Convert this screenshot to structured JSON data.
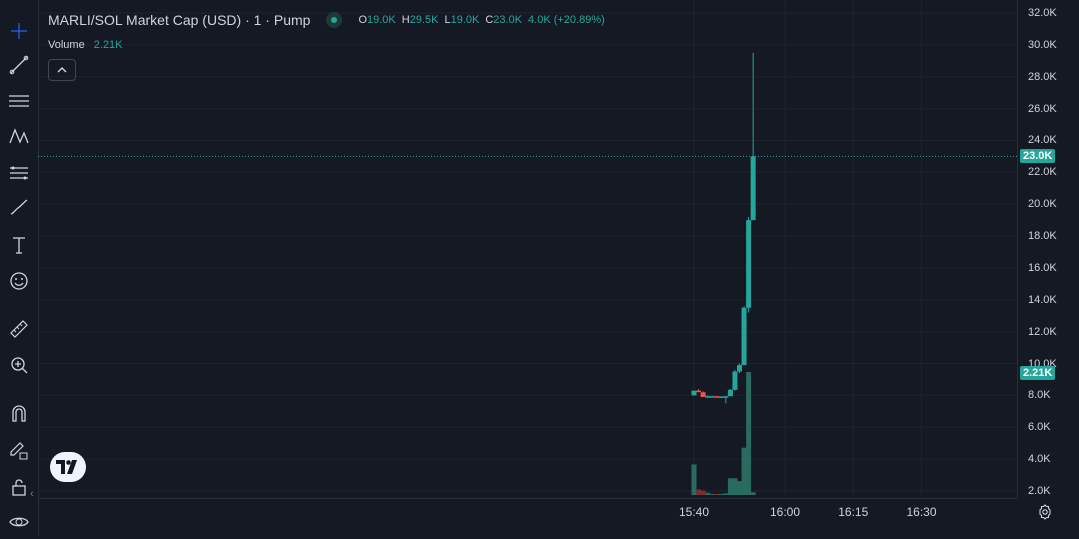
{
  "legend": {
    "title": "MARLI/SOL Market Cap (USD) · 1 · Pump",
    "open_label": "O",
    "open": "19.0K",
    "high_label": "H",
    "high": "29.5K",
    "low_label": "L",
    "low": "19.0K",
    "close_label": "C",
    "close": "23.0K",
    "change": "4.0K (+20.89%)"
  },
  "volume_legend": {
    "label": "Volume",
    "value": "2.21K"
  },
  "toggle": {
    "icon": "chevron-up-icon"
  },
  "logo": {
    "text": "TV"
  },
  "price_badge": {
    "value": "23.0K",
    "color": "#26a69a"
  },
  "volume_badge": {
    "value": "2.21K",
    "color": "#26a69a"
  },
  "toolbar": {
    "tools": [
      "crosshair-icon",
      "trendline-icon",
      "horizontal-lines-icon",
      "pattern-icon",
      "fib-icon",
      "brush-icon",
      "text-icon",
      "emoji-icon",
      "ruler-icon",
      "zoom-icon",
      "magnet-icon",
      "lock-pencil-icon",
      "lock-icon",
      "eye-icon"
    ]
  },
  "colors": {
    "up": "#26a69a",
    "down": "#ef5350",
    "vol_up": "#2a6b5f",
    "vol_down": "#7a2e2e",
    "grid": "#1e222d"
  },
  "chart_data": {
    "type": "candlestick",
    "yticks": [
      "32.0K",
      "30.0K",
      "28.0K",
      "26.0K",
      "24.0K",
      "22.0K",
      "20.0K",
      "18.0K",
      "16.0K",
      "14.0K",
      "12.0K",
      "10.0K",
      "8.0K",
      "6.0K",
      "4.0K",
      "2.0K"
    ],
    "xticks": [
      "15:40",
      "16:00",
      "16:15",
      "16:30"
    ],
    "ylim": [
      1500,
      32500
    ],
    "xlim": [
      "15:30",
      "16:40"
    ],
    "last_price": 23000,
    "candles": [
      {
        "t": "15:40",
        "o": 8000,
        "h": 8300,
        "l": 8000,
        "c": 8300,
        "v": 0.55
      },
      {
        "t": "15:41",
        "o": 8300,
        "h": 8400,
        "l": 8200,
        "c": 8250,
        "v": 0.1
      },
      {
        "t": "15:42",
        "o": 8200,
        "h": 8250,
        "l": 7900,
        "c": 7900,
        "v": 0.08
      },
      {
        "t": "15:43",
        "o": 7900,
        "h": 8000,
        "l": 7850,
        "c": 7950,
        "v": 0.04
      },
      {
        "t": "15:44",
        "o": 7950,
        "h": 7980,
        "l": 7900,
        "c": 7950,
        "v": 0.02
      },
      {
        "t": "15:45",
        "o": 7950,
        "h": 7960,
        "l": 7900,
        "c": 7930,
        "v": 0.02
      },
      {
        "t": "15:46",
        "o": 7930,
        "h": 7950,
        "l": 7900,
        "c": 7930,
        "v": 0.02
      },
      {
        "t": "15:47",
        "o": 7930,
        "h": 7950,
        "l": 7500,
        "c": 7950,
        "v": 0.03
      },
      {
        "t": "15:48",
        "o": 7950,
        "h": 8400,
        "l": 7950,
        "c": 8350,
        "v": 0.3
      },
      {
        "t": "15:49",
        "o": 8350,
        "h": 9600,
        "l": 8300,
        "c": 9500,
        "v": 0.3
      },
      {
        "t": "15:50",
        "o": 9500,
        "h": 10000,
        "l": 9400,
        "c": 9900,
        "v": 0.25
      },
      {
        "t": "15:51",
        "o": 9900,
        "h": 13600,
        "l": 9900,
        "c": 13500,
        "v": 0.85
      },
      {
        "t": "15:52",
        "o": 13500,
        "h": 19200,
        "l": 13200,
        "c": 19000,
        "v": 2.21
      },
      {
        "t": "15:53",
        "o": 19000,
        "h": 29500,
        "l": 19000,
        "c": 23000,
        "v": 0.05
      }
    ]
  }
}
